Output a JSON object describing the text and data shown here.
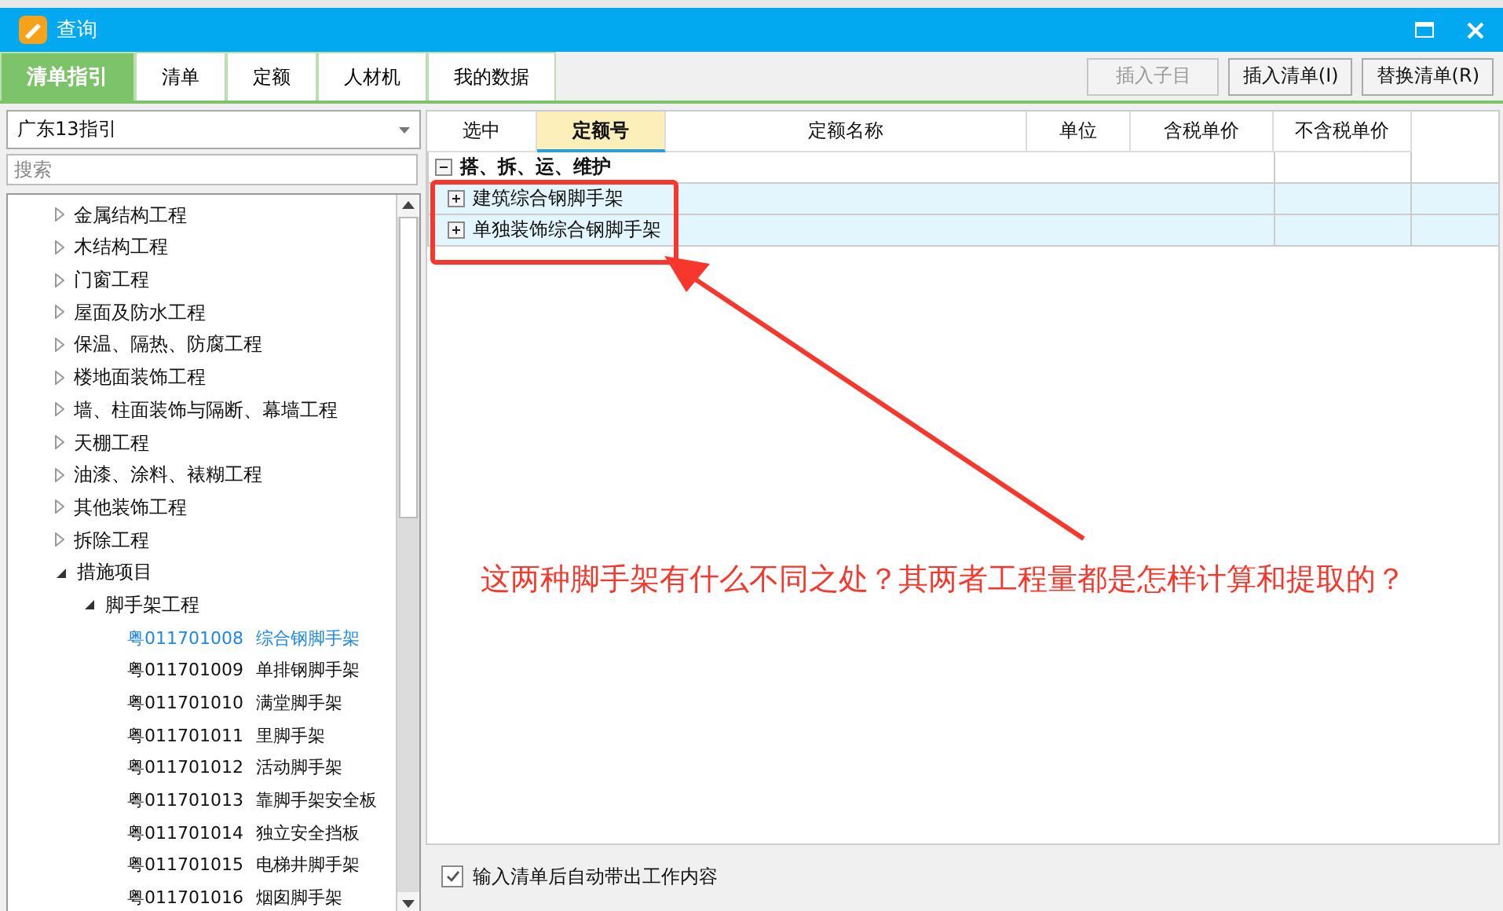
{
  "window": {
    "title": "查询"
  },
  "tabs": [
    {
      "label": "清单指引",
      "selected": true
    },
    {
      "label": "清单",
      "selected": false
    },
    {
      "label": "定额",
      "selected": false
    },
    {
      "label": "人材机",
      "selected": false
    },
    {
      "label": "我的数据",
      "selected": false
    }
  ],
  "toolbar_buttons": [
    {
      "label": "插入子目",
      "disabled": true
    },
    {
      "label": "插入清单(I)",
      "disabled": false
    },
    {
      "label": "替换清单(R)",
      "disabled": false
    }
  ],
  "sidebar": {
    "dropdown": {
      "value": "广东13指引"
    },
    "search": {
      "placeholder": "搜索"
    },
    "tree": [
      {
        "label": "金属结构工程",
        "expanded": false
      },
      {
        "label": "木结构工程",
        "expanded": false
      },
      {
        "label": "门窗工程",
        "expanded": false
      },
      {
        "label": "屋面及防水工程",
        "expanded": false
      },
      {
        "label": "保温、隔热、防腐工程",
        "expanded": false
      },
      {
        "label": "楼地面装饰工程",
        "expanded": false
      },
      {
        "label": "墙、柱面装饰与隔断、幕墙工程",
        "expanded": false
      },
      {
        "label": "天棚工程",
        "expanded": false
      },
      {
        "label": "油漆、涂料、裱糊工程",
        "expanded": false
      },
      {
        "label": "其他装饰工程",
        "expanded": false
      },
      {
        "label": "拆除工程",
        "expanded": false
      },
      {
        "label": "措施项目",
        "expanded": true,
        "children": [
          {
            "label": "脚手架工程",
            "expanded": true,
            "children": [
              {
                "code": "粤011701008",
                "name": "综合钢脚手架",
                "selected": true
              },
              {
                "code": "粤011701009",
                "name": "单排钢脚手架",
                "selected": false
              },
              {
                "code": "粤011701010",
                "name": "满堂脚手架",
                "selected": false
              },
              {
                "code": "粤011701011",
                "name": "里脚手架",
                "selected": false
              },
              {
                "code": "粤011701012",
                "name": "活动脚手架",
                "selected": false
              },
              {
                "code": "粤011701013",
                "name": "靠脚手架安全板",
                "selected": false
              },
              {
                "code": "粤011701014",
                "name": "独立安全挡板",
                "selected": false
              },
              {
                "code": "粤011701015",
                "name": "电梯井脚手架",
                "selected": false
              },
              {
                "code": "粤011701016",
                "name": "烟囱脚手架",
                "selected": false
              }
            ]
          }
        ]
      }
    ]
  },
  "table": {
    "columns": [
      {
        "label": "选中",
        "selected": false
      },
      {
        "label": "定额号",
        "selected": true
      },
      {
        "label": "定额名称",
        "selected": false
      },
      {
        "label": "单位",
        "selected": false
      },
      {
        "label": "含税单价",
        "selected": false
      },
      {
        "label": "不含税单价",
        "selected": false
      }
    ],
    "rows": [
      {
        "label": "搭、拆、运、维护",
        "expanded": true,
        "children": [
          {
            "label": "建筑综合钢脚手架",
            "expanded": false
          },
          {
            "label": "单独装饰综合钢脚手架",
            "expanded": false
          }
        ]
      }
    ]
  },
  "option": {
    "label": "输入清单后自动带出工作内容",
    "checked": true
  },
  "annotation": {
    "text": "这两种脚手架有什么不同之处？其两者工程量都是怎样计算和提取的？"
  }
}
